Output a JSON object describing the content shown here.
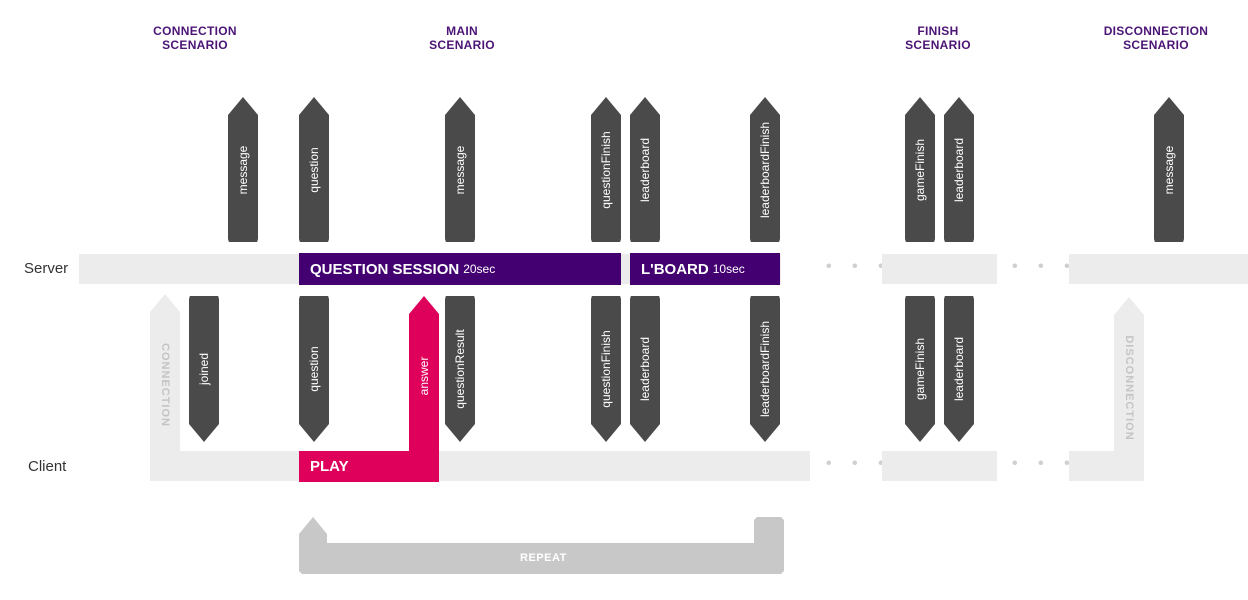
{
  "scenarios": {
    "connection": "CONNECTION\nSCENARIO",
    "main": "MAIN\nSCENARIO",
    "finish": "FINISH\nSCENARIO",
    "disconnection": "DISCONNECTION\nSCENARIO"
  },
  "lanes": {
    "server": "Server",
    "client": "Client"
  },
  "blocks": {
    "question_session": {
      "label": "QUESTION SESSION",
      "duration": "20sec"
    },
    "leaderboard": {
      "label": "L'BOARD",
      "duration": "10sec"
    },
    "play": {
      "label": "PLAY"
    }
  },
  "server_events": [
    "message",
    "question",
    "message",
    "questionFinish",
    "leaderboard",
    "leaderboardFinish",
    "gameFinish",
    "leaderboard",
    "message"
  ],
  "client_events": [
    "joined",
    "question",
    "answer",
    "questionResult",
    "questionFinish",
    "leaderboard",
    "leaderboardFinish",
    "gameFinish",
    "leaderboard"
  ],
  "connectors": {
    "connection": "CONNECTION",
    "disconnection": "DISCONNECTION",
    "repeat": "REPEAT"
  },
  "ellipsis": "• • •",
  "colors": {
    "scenario_title": "#4b1475",
    "server_block": "#430070",
    "play_block": "#de005b",
    "event_arrow": "#4a4a4a",
    "track": "#ececec",
    "connector": "#c8c8c8"
  }
}
